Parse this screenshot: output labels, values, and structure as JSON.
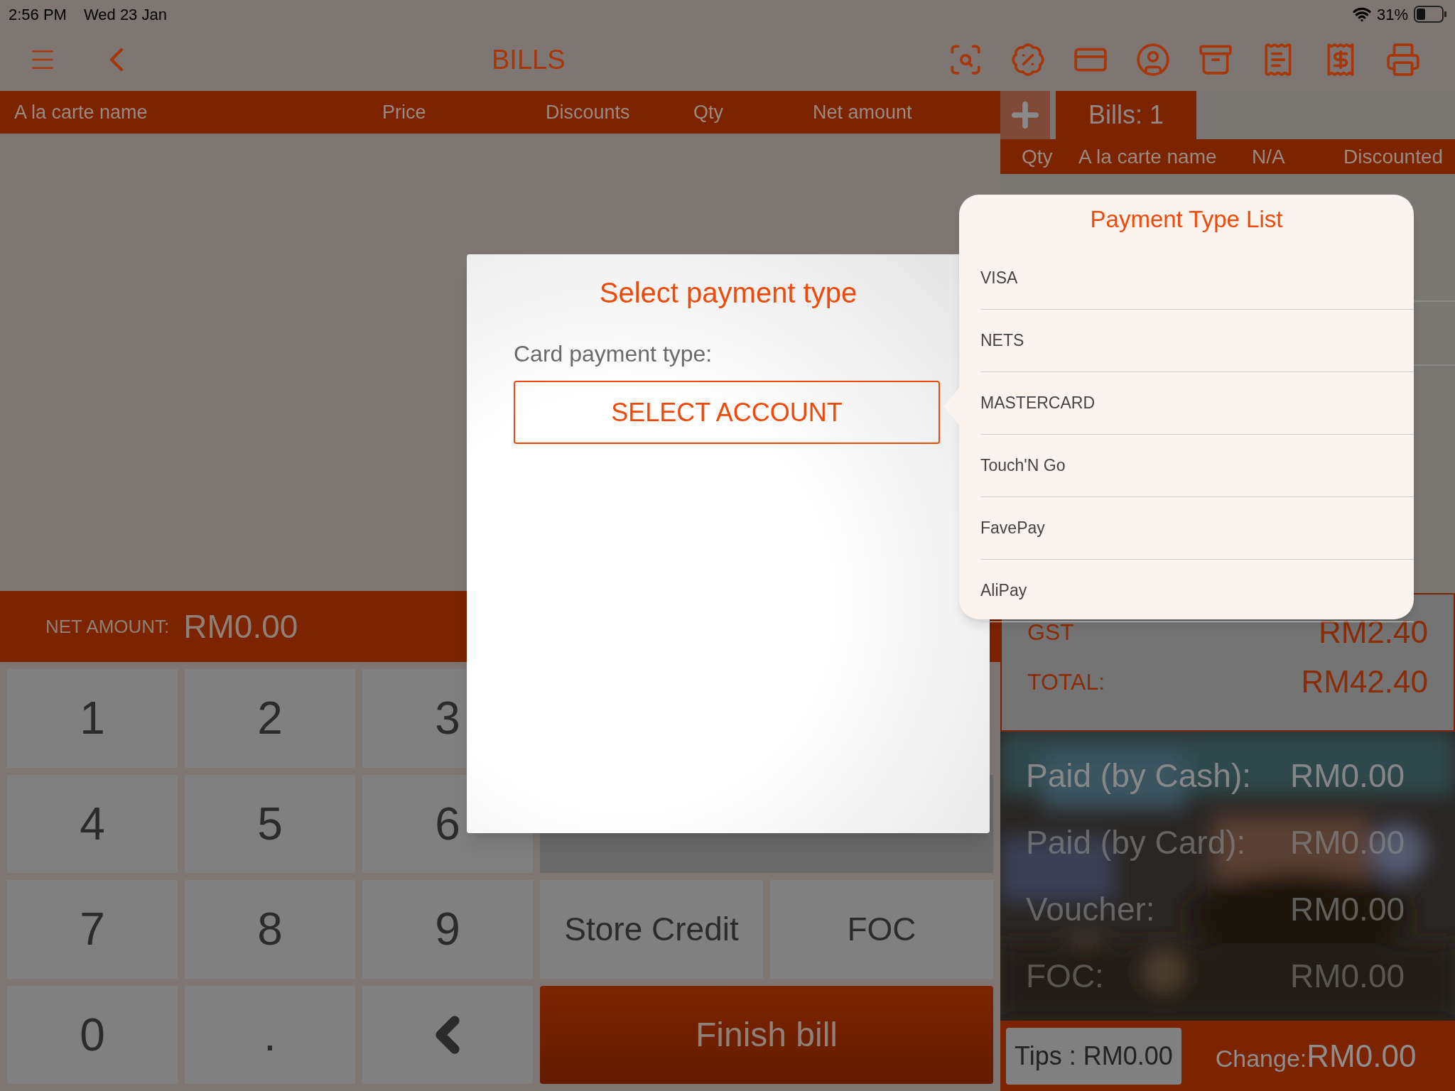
{
  "status_bar": {
    "time": "2:56 PM",
    "date": "Wed 23 Jan",
    "battery": "31%"
  },
  "toolbar": {
    "title": "BILLS"
  },
  "table": {
    "columns": [
      "A la carte name",
      "Price",
      "Discounts",
      "Qty",
      "Net amount"
    ]
  },
  "net_amount": {
    "label": "NET AMOUNT:",
    "value": "RM0.00"
  },
  "keypad": [
    {
      "kind": "key",
      "label": "1"
    },
    {
      "kind": "key",
      "label": "2"
    },
    {
      "kind": "key",
      "label": "3"
    },
    {
      "kind": "key",
      "label": "4"
    },
    {
      "kind": "key",
      "label": "5"
    },
    {
      "kind": "key",
      "label": "6"
    },
    {
      "kind": "key",
      "label": "7"
    },
    {
      "kind": "key",
      "label": "8"
    },
    {
      "kind": "key",
      "label": "9"
    },
    {
      "kind": "key",
      "label": "0"
    },
    {
      "kind": "key",
      "label": "."
    },
    {
      "kind": "backspace"
    }
  ],
  "actions": [
    {
      "kind": "plain",
      "label": "Store Credit"
    },
    {
      "kind": "plain",
      "label": "FOC"
    },
    {
      "kind": "primary",
      "label": "Finish bill"
    }
  ],
  "bills_panel": {
    "tab": "Bills: 1",
    "columns": [
      "Qty",
      "A la carte name",
      "N/A",
      "Discounted"
    ],
    "totals": [
      {
        "label": "GST",
        "value": "RM2.40"
      },
      {
        "label": "TOTAL:",
        "value": "RM42.40"
      }
    ],
    "payments": [
      {
        "label": "Paid (by Cash):",
        "value": "RM0.00"
      },
      {
        "label": "Paid (by Card):",
        "value": "RM0.00"
      },
      {
        "label": "Voucher:",
        "value": "RM0.00"
      },
      {
        "label": "FOC:",
        "value": "RM0.00"
      }
    ],
    "tips": "Tips : RM0.00",
    "change_label": "Change:",
    "change_value": "RM0.00"
  },
  "dialog": {
    "title": "Select payment type",
    "field_label": "Card payment type:",
    "button": "SELECT ACCOUNT"
  },
  "popover": {
    "title": "Payment Type List",
    "items": [
      "VISA",
      "NETS",
      "MASTERCARD",
      "Touch'N Go",
      "FavePay",
      "AliPay"
    ]
  }
}
